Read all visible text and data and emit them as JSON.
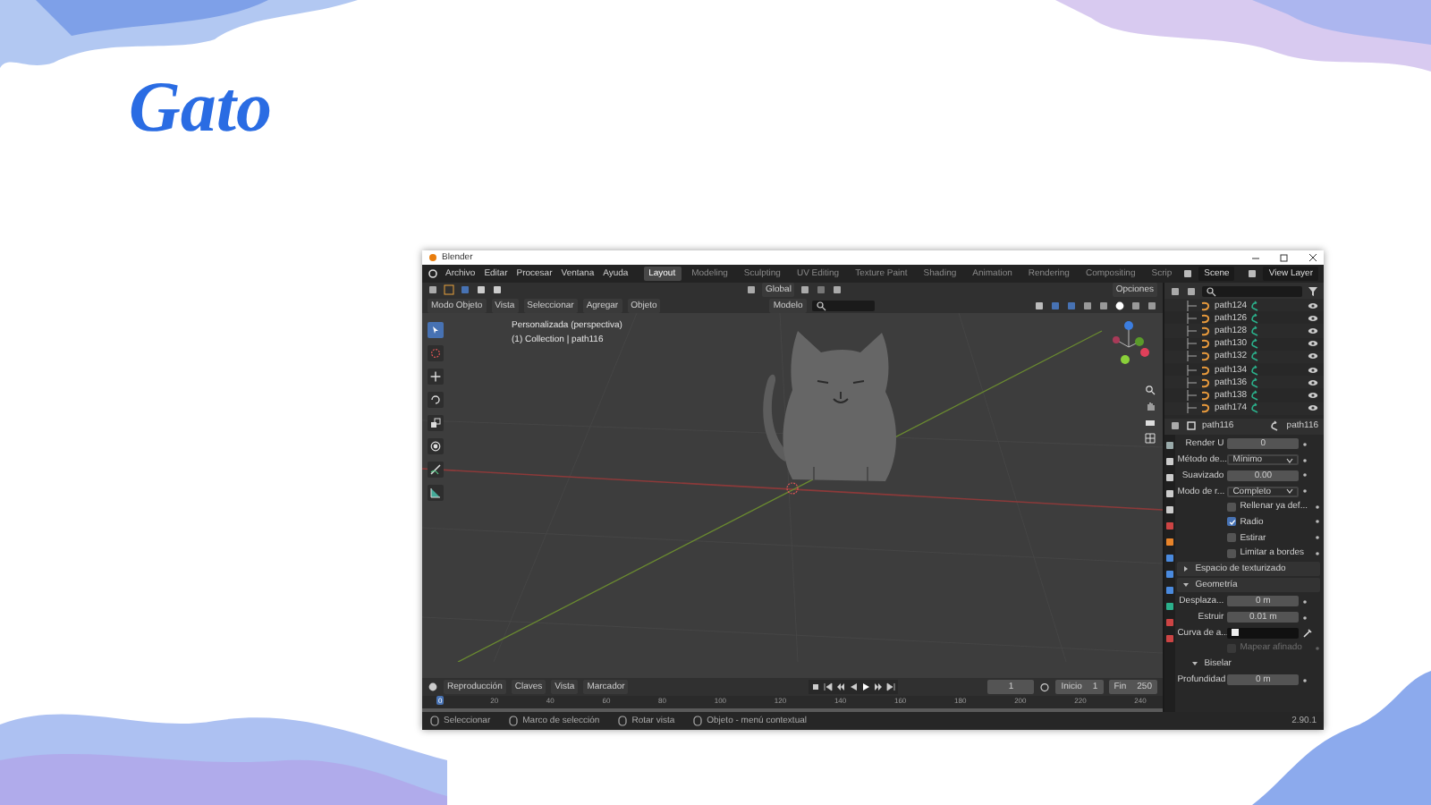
{
  "slide": {
    "title": "Gato"
  },
  "window": {
    "title": "Blender",
    "menus": [
      "Archivo",
      "Editar",
      "Procesar",
      "Ventana",
      "Ayuda"
    ],
    "workspace_tabs": [
      {
        "label": "Layout",
        "selected": true
      },
      {
        "label": "Modeling",
        "selected": false
      },
      {
        "label": "Sculpting",
        "selected": false
      },
      {
        "label": "UV Editing",
        "selected": false
      },
      {
        "label": "Texture Paint",
        "selected": false
      },
      {
        "label": "Shading",
        "selected": false
      },
      {
        "label": "Animation",
        "selected": false
      },
      {
        "label": "Rendering",
        "selected": false
      },
      {
        "label": "Compositing",
        "selected": false
      },
      {
        "label": "Scrip",
        "selected": false
      }
    ],
    "scene": "Scene",
    "view_layer": "View Layer"
  },
  "viewport": {
    "orientation": "Global",
    "options": "Opciones",
    "mode": "Modo Objeto",
    "menus": [
      "Vista",
      "Seleccionar",
      "Agregar",
      "Objeto"
    ],
    "snap": "Modelo",
    "view_name": "Personalizada (perspectiva)",
    "collection_info": "(1) Collection | path116",
    "tools": [
      {
        "selected": true
      },
      {
        "selected": false
      },
      {
        "selected": false
      },
      {
        "selected": false
      },
      {
        "selected": false
      },
      {
        "selected": false
      },
      {
        "selected": false
      },
      {
        "selected": false
      }
    ]
  },
  "outliner": {
    "items": [
      "path124",
      "path126",
      "path128",
      "path130",
      "path132",
      "path134",
      "path136",
      "path138",
      "path174"
    ]
  },
  "properties": {
    "object": "path116",
    "data": "path116",
    "rows": [
      {
        "kind": "field",
        "label": "Render U",
        "value": "0"
      },
      {
        "kind": "dropdown",
        "label": "Método de...",
        "value": "Mínimo"
      },
      {
        "kind": "field",
        "label": "Suavizado",
        "value": "0.00"
      },
      {
        "kind": "dropdown",
        "label": "Modo de r...",
        "value": "Completo"
      },
      {
        "kind": "checkbox",
        "label": "Rellenar ya def...",
        "checked": false,
        "disabled": false
      },
      {
        "kind": "checkbox",
        "label": "Radio",
        "checked": true,
        "disabled": false
      },
      {
        "kind": "checkbox",
        "label": "Estirar",
        "checked": false,
        "disabled": false
      },
      {
        "kind": "checkbox",
        "label": "Limitar a bordes",
        "checked": false,
        "disabled": false
      },
      {
        "kind": "section",
        "label": "Espacio de texturizado",
        "expanded": false
      },
      {
        "kind": "section",
        "label": "Geometría",
        "expanded": true
      },
      {
        "kind": "field",
        "label": "Desplaza...",
        "value": "0 m"
      },
      {
        "kind": "field",
        "label": "Estruir",
        "value": "0.01 m"
      },
      {
        "kind": "curve",
        "label": "Curva de a..."
      },
      {
        "kind": "checkbox",
        "label": "Mapear afinado",
        "checked": false,
        "disabled": true
      },
      {
        "kind": "subsection",
        "label": "Biselar",
        "expanded": true
      },
      {
        "kind": "field",
        "label": "Profundidad",
        "value": "0 m"
      }
    ]
  },
  "timeline": {
    "menus": [
      "Reproducción",
      "Claves",
      "Vista",
      "Marcador"
    ],
    "current_frame": "1",
    "start_label": "Inicio",
    "start": "1",
    "end_label": "Fin",
    "end": "250",
    "ruler": [
      "0",
      "20",
      "40",
      "60",
      "80",
      "100",
      "120",
      "140",
      "160",
      "180",
      "200",
      "220",
      "240"
    ]
  },
  "status_bar": {
    "hints": [
      "Seleccionar",
      "Marco de selección",
      "Rotar vista",
      "Objeto - menú contextual"
    ],
    "version": "2.90.1"
  }
}
